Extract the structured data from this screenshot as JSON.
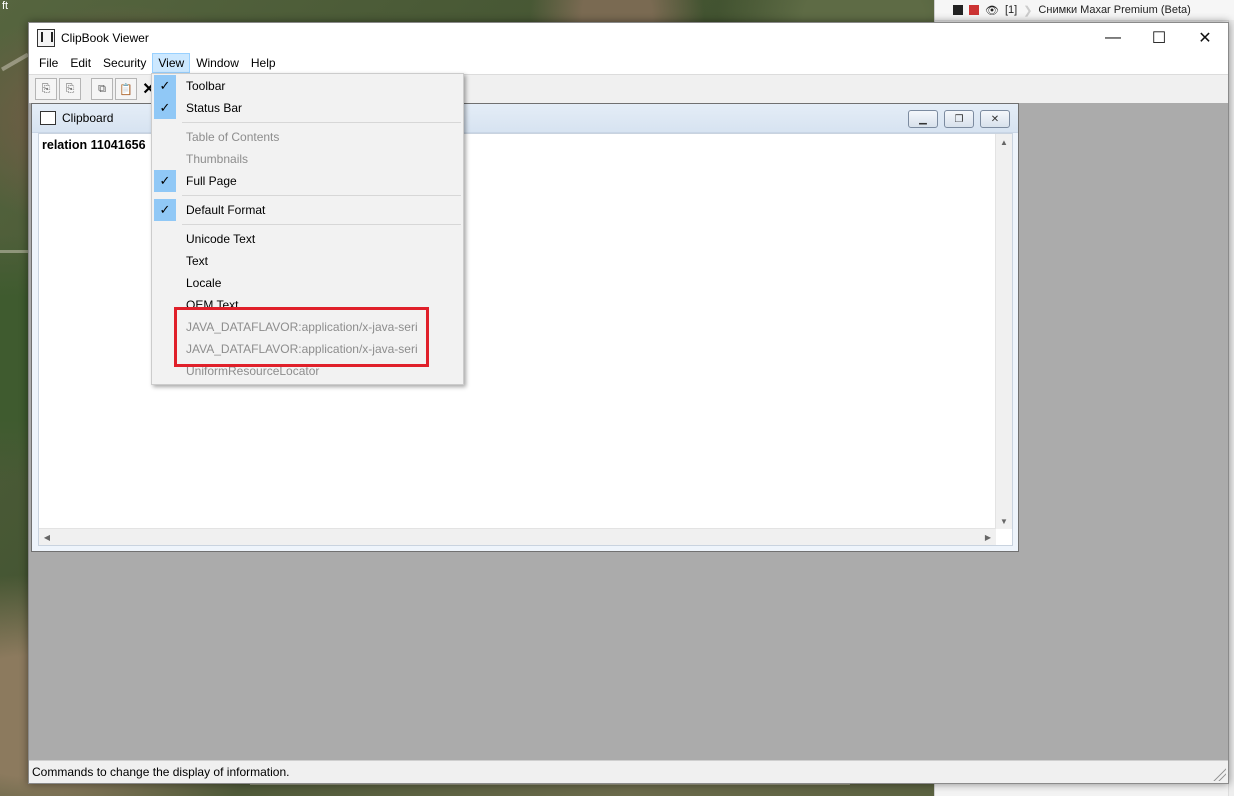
{
  "right_panel": {
    "layer_badge": "[1]",
    "layer_name": "Снимки Maxar Premium (Beta)"
  },
  "map": {
    "corner_label": "ft"
  },
  "window": {
    "title": "ClipBook Viewer",
    "menu": [
      "File",
      "Edit",
      "Security",
      "View",
      "Window",
      "Help"
    ],
    "status_text": "Commands to change the display of information."
  },
  "child_window": {
    "title": "Clipboard",
    "content_text": "relation 11041656"
  },
  "view_menu": {
    "items": [
      {
        "label": "Toolbar",
        "checked": true,
        "enabled": true
      },
      {
        "label": "Status Bar",
        "checked": true,
        "enabled": true
      },
      {
        "label": "Table of Contents",
        "checked": false,
        "enabled": false
      },
      {
        "label": "Thumbnails",
        "checked": false,
        "enabled": false
      },
      {
        "label": "Full Page",
        "checked": true,
        "enabled": true
      },
      {
        "label": "Default Format",
        "checked": true,
        "enabled": true
      },
      {
        "label": "Unicode Text",
        "checked": false,
        "enabled": true
      },
      {
        "label": "Text",
        "checked": false,
        "enabled": true
      },
      {
        "label": "Locale",
        "checked": false,
        "enabled": true
      },
      {
        "label": "OEM Text",
        "checked": false,
        "enabled": true
      },
      {
        "label": "JAVA_DATAFLAVOR:application/x-java-seri",
        "checked": false,
        "enabled": false
      },
      {
        "label": "JAVA_DATAFLAVOR:application/x-java-seri",
        "checked": false,
        "enabled": false
      },
      {
        "label": "UniformResourceLocator",
        "checked": false,
        "enabled": false
      }
    ]
  },
  "colors": {
    "highlight_box": "#e0202a",
    "menu_check_bg": "#90c8f6",
    "mdi_background": "#ababab"
  }
}
